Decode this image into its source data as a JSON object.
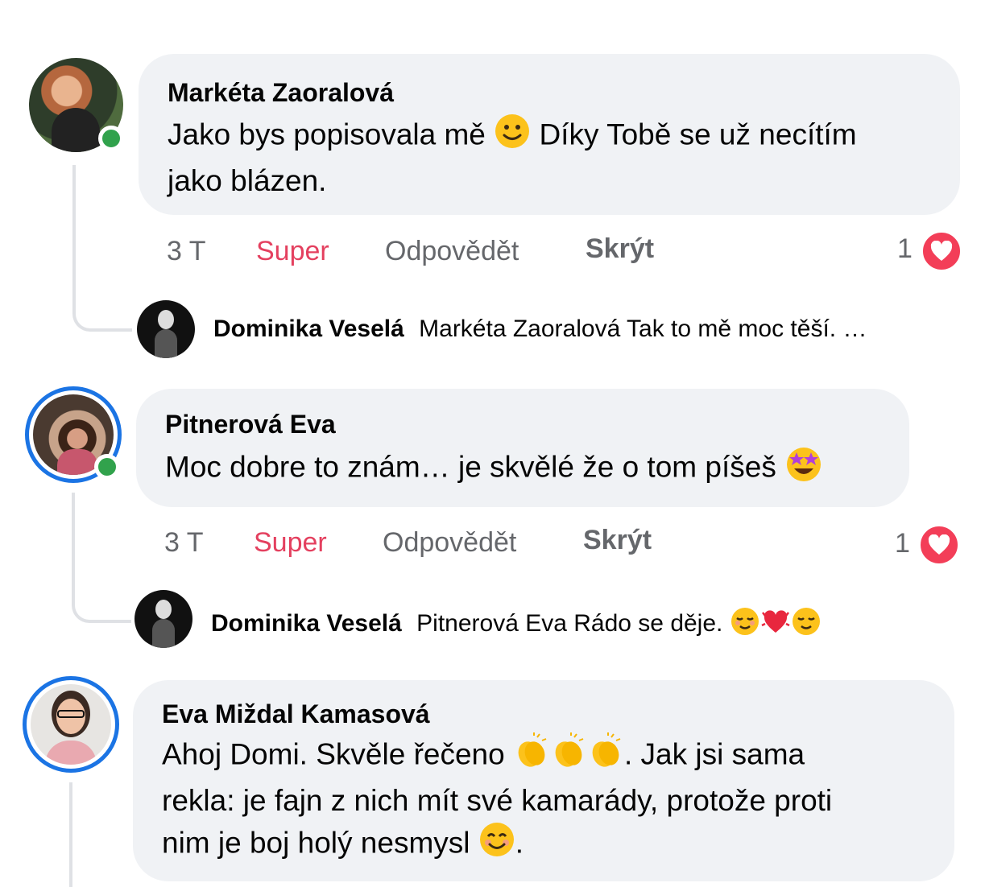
{
  "colors": {
    "bubble": "#f0f2f5",
    "super_reaction": "#e4405f",
    "meta_text": "#65676b",
    "online": "#31a24c",
    "story_ring": "#1b74e4",
    "heart": "#f33e58"
  },
  "comments": [
    {
      "author": "Markéta Zaoralová",
      "text_line1": "Jako bys popisovala mě",
      "text_line1_after": "Díky Tobě se už necítím",
      "text_line2": "jako blázen.",
      "emoji_icon": "slightly-smiling-face-icon",
      "time": "3 T",
      "super": "Super",
      "reply": "Odpovědět",
      "hide": "Skrýt",
      "reaction_count": "1",
      "reaction_icon": "heart-icon",
      "online": true,
      "story_ring": false,
      "reply_preview": {
        "author": "Dominika Veselá",
        "text": "Markéta Zaoralová Tak to mě moc těší. …"
      }
    },
    {
      "author": "Pitnerová Eva",
      "text_line1": "Moc dobre to znám… je skvělé že o tom píšeš",
      "emoji_icon": "star-struck-icon",
      "time": "3 T",
      "super": "Super",
      "reply": "Odpovědět",
      "hide": "Skrýt",
      "reaction_count": "1",
      "reaction_icon": "heart-icon",
      "online": true,
      "story_ring": true,
      "reply_preview": {
        "author": "Dominika Veselá",
        "text": "Pitnerová Eva Rádo se děje.",
        "emoji_icons": [
          "relieved-face-icon",
          "beating-heart-icon",
          "relieved-face-icon"
        ]
      }
    },
    {
      "author": "Eva Miždal Kamasová",
      "text_line1": "Ahoj Domi. Skvěle řečeno",
      "text_line1_after": ".  Jak jsi sama",
      "text_line2": "rekla: je fajn z nich mít své kamarády, protože proti",
      "text_line3": "nim je boj holý nesmysl",
      "text_line3_after": ".",
      "emoji_icons": [
        "clapping-hands-icon",
        "clapping-hands-icon",
        "clapping-hands-icon"
      ],
      "emoji_end_icon": "smiling-face-with-smiling-eyes-icon",
      "online": false,
      "story_ring": true
    }
  ]
}
